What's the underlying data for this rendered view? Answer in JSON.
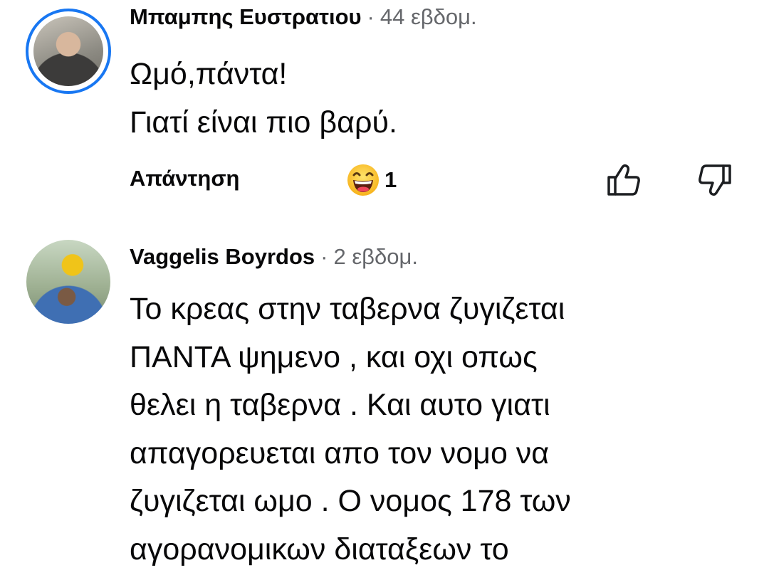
{
  "comments": [
    {
      "author": "Μπαμπης Ευστρατιου",
      "separator": "·",
      "time": "44 εβδομ.",
      "text_lines": [
        "Ωμό,πάντα!",
        "Γιατί είναι πιο βαρύ."
      ],
      "reply_label": "Απάντηση",
      "reaction_icon": "laughing-emoji-icon",
      "reaction_count": "1"
    },
    {
      "author": "Vaggelis Boyrdos",
      "separator": "·",
      "time": "2 εβδομ.",
      "text_lines": [
        "Το κρεας στην ταβερνα ζυγιζεται",
        "ΠΑΝΤΑ ψημενο , και οχι οπως",
        "θελει η ταβερνα . Και αυτο γιατι",
        "απαγορευεται απο τον νομο να",
        "ζυγιζεται ωμο . Ο νομος 178 των",
        "αγορανομικων διαταξεων το"
      ]
    }
  ],
  "colors": {
    "avatar_ring": "#1877f2",
    "secondary_text": "#65676b",
    "primary_text": "#080809"
  }
}
